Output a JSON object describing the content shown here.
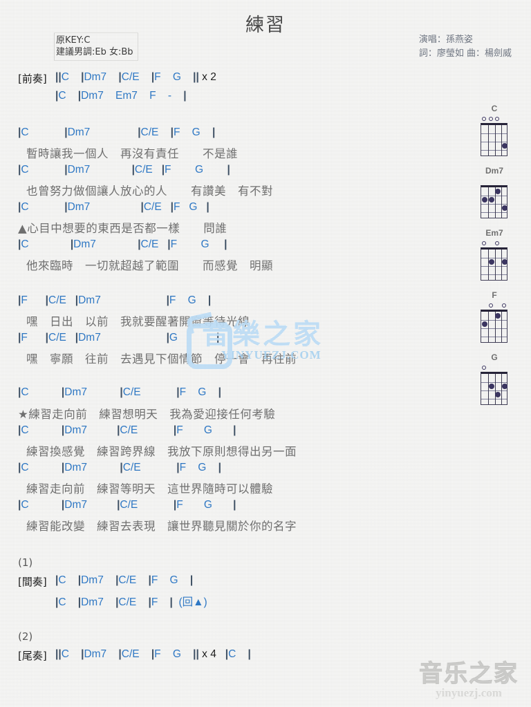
{
  "title": "練習",
  "key_info": {
    "original_key": "原KEY:C",
    "suggested_key": "建議男調:Eb 女:Bb"
  },
  "credits": {
    "singer": "演唱：孫燕姿",
    "writers": "詞：廖瑩如  曲：楊劍威"
  },
  "sections": {
    "intro_tag": "[前奏]",
    "interlude_tag": "[間奏]",
    "outro_tag": "[尾奏]",
    "marker_1": "(1)",
    "marker_2": "(2)",
    "repeat_x2": "|| x 2",
    "repeat_x4": "|| x 4",
    "dc_note": "(回▲)"
  },
  "lines": [
    {
      "id": "intro-1",
      "type": "chord",
      "text": "||C    |Dm7    |C/E    |F    G    || x 2"
    },
    {
      "id": "intro-2",
      "type": "chord",
      "text": "|C    |Dm7    Em7    F    -    |"
    },
    {
      "id": "v1-c1",
      "type": "chord",
      "text": "|C            |Dm7                |C/E    |F    G    |"
    },
    {
      "id": "v1-l1",
      "type": "lyric",
      "text": "暫時讓我一個人　再沒有責任　　不是誰"
    },
    {
      "id": "v1-c2",
      "type": "chord",
      "text": "|C            |Dm7              |C/E   |F        G        |"
    },
    {
      "id": "v1-l2",
      "type": "lyric",
      "text": "也曾努力做個讓人放心的人　　有讚美　有不對"
    },
    {
      "id": "v1-c3",
      "type": "chord",
      "text": "|C            |Dm7                 |C/E   |F   G   |"
    },
    {
      "id": "v1-l3",
      "type": "lyric",
      "text": "▲心目中想要的東西是否都一樣　　問誰"
    },
    {
      "id": "v1-c4",
      "type": "chord",
      "text": "|C              |Dm7              |C/E   |F        G     |"
    },
    {
      "id": "v1-l4",
      "type": "lyric",
      "text": "他來臨時　一切就超越了範圍　　而感覺　明顯"
    },
    {
      "id": "pc-c1",
      "type": "chord",
      "text": "|F      |C/E   |Dm7                      |F    G    |"
    },
    {
      "id": "pc-l1",
      "type": "lyric",
      "text": "嘿　日出　以前　我就要醒著開窗等待光線"
    },
    {
      "id": "pc-c2",
      "type": "chord",
      "text": "|F      |C/E   |Dm7                      |G             |"
    },
    {
      "id": "pc-l2",
      "type": "lyric",
      "text": "嘿　寧願　往前　去遇見下個情節　停一會　再往前"
    },
    {
      "id": "ch-c1",
      "type": "chord",
      "text": "|C           |Dm7           |C/E            |F    G    |"
    },
    {
      "id": "ch-l1",
      "type": "lyric",
      "text": "★練習走向前　練習想明天　我為愛迎接任何考驗"
    },
    {
      "id": "ch-c2",
      "type": "chord",
      "text": "|C           |Dm7          |C/E            |F       G       |"
    },
    {
      "id": "ch-l2",
      "type": "lyric",
      "text": "練習換感覺　練習跨界線　我放下原則想得出另一面"
    },
    {
      "id": "ch-c3",
      "type": "chord",
      "text": "|C           |Dm7           |C/E            |F    G    |"
    },
    {
      "id": "ch-l3",
      "type": "lyric",
      "text": "練習走向前　練習等明天　這世界隨時可以體驗"
    },
    {
      "id": "ch-c4",
      "type": "chord",
      "text": "|C           |Dm7          |C/E            |F       G       |"
    },
    {
      "id": "ch-l4",
      "type": "lyric",
      "text": "練習能改變　練習去表現　讓世界聽見關於你的名字"
    },
    {
      "id": "int-1",
      "type": "chord",
      "text": "|C    |Dm7    |C/E    |F    G    |"
    },
    {
      "id": "int-2",
      "type": "chord",
      "text": "|C    |Dm7    |C/E    |F    |  (回▲)"
    },
    {
      "id": "out-1",
      "type": "chord",
      "text": "||C    |Dm7    |C/E    |F    G    || x 4   |C    |"
    }
  ],
  "chord_diagrams": [
    {
      "name": "C",
      "open_strings": [
        1,
        2,
        3
      ],
      "muted_strings": [],
      "dots": [
        {
          "string": 4,
          "fret": 3
        }
      ]
    },
    {
      "name": "Dm7",
      "open_strings": [],
      "muted_strings": [],
      "dots": [
        {
          "string": 1,
          "fret": 2
        },
        {
          "string": 2,
          "fret": 2
        },
        {
          "string": 3,
          "fret": 1
        },
        {
          "string": 4,
          "fret": 3
        }
      ]
    },
    {
      "name": "Em7",
      "open_strings": [
        1,
        3
      ],
      "muted_strings": [],
      "dots": [
        {
          "string": 2,
          "fret": 2
        },
        {
          "string": 4,
          "fret": 2
        }
      ]
    },
    {
      "name": "F",
      "open_strings": [
        2,
        4
      ],
      "muted_strings": [],
      "dots": [
        {
          "string": 1,
          "fret": 2
        },
        {
          "string": 3,
          "fret": 1
        }
      ]
    },
    {
      "name": "G",
      "open_strings": [
        1
      ],
      "muted_strings": [],
      "dots": [
        {
          "string": 2,
          "fret": 2
        },
        {
          "string": 3,
          "fret": 3
        },
        {
          "string": 4,
          "fret": 2
        }
      ]
    }
  ],
  "watermarks": {
    "center_logo": "音樂之家",
    "center_url": "YINYUEZJ.COM",
    "bottom_logo": "音乐之家",
    "bottom_url": "yinyuezj.com"
  },
  "colors": {
    "chord_blue": "#2f78c4",
    "lyric_gray": "#6f6f6f",
    "bar_navy": "#3d4f63",
    "diagram_dot": "#3b3560",
    "watermark_blue": "#bcdcf5",
    "watermark_gray": "#d6d6d4",
    "paper": "#f3f3f1"
  }
}
